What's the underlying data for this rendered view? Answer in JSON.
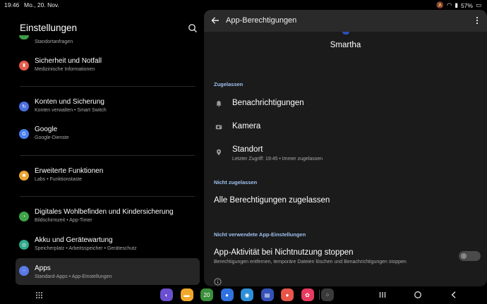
{
  "statusbar": {
    "time": "19:46",
    "date": "Mo., 20. Nov.",
    "battery": "57%"
  },
  "left": {
    "title": "Einstellungen",
    "partial_item_sub": "Standortanfragen",
    "items": [
      {
        "title": "Sicherheit und Notfall",
        "sub": "Medizinische Informationen",
        "color": "#e55a4a",
        "glyph": "♜"
      },
      {
        "title": "Konten und Sicherung",
        "sub": "Konten verwalten  •  Smart Switch",
        "color": "#4a6fe0",
        "glyph": "↻"
      },
      {
        "title": "Google",
        "sub": "Google-Dienste",
        "color": "#4a7ff0",
        "glyph": "G"
      },
      {
        "title": "Erweiterte Funktionen",
        "sub": "Labs  •  Funktionstaste",
        "color": "#e8a531",
        "glyph": "✱"
      },
      {
        "title": "Digitales Wohlbefinden und Kindersicherung",
        "sub": "Bildschirmzeit  •  App-Timer",
        "color": "#3fa44a",
        "glyph": "◔"
      },
      {
        "title": "Akku und Gerätewartung",
        "sub": "Speicherplatz  •  Arbeitsspeicher  •  Geräteschutz",
        "color": "#2fa98a",
        "glyph": "◎"
      },
      {
        "title": "Apps",
        "sub": "Standard-Apps  •  App-Einstellungen",
        "color": "#5a7ae8",
        "glyph": "⁘"
      }
    ]
  },
  "right": {
    "header_title": "App-Berechtigungen",
    "app_name": "Smartha",
    "section_allowed": "Zugelassen",
    "perm_notifications": "Benachrichtigungen",
    "perm_camera": "Kamera",
    "perm_location": "Standort",
    "perm_location_sub": "Letzter Zugriff: 19:45 • Immer zugelassen",
    "section_denied": "Nicht zugelassen",
    "allow_all": "Alle Berechtigungen zugelassen",
    "section_unused": "Nicht verwendete App-Einstellungen",
    "pause_title": "App-Aktivität bei Nichtnutzung stoppen",
    "pause_sub": "Berechtigungen entfernen, temporäre Dateien löschen und Benachrichtigungen stoppen",
    "pause_toggle": false
  },
  "taskbar": {
    "apps": [
      {
        "name": "samsung-internet-app",
        "color": "#6b4fd0",
        "glyph": "◐"
      },
      {
        "name": "files-app",
        "color": "#f1a82a",
        "glyph": "▬"
      },
      {
        "name": "calendar-app",
        "color": "#3b8f3a",
        "glyph": "20"
      },
      {
        "name": "messages-app",
        "color": "#2f72e0",
        "glyph": "●"
      },
      {
        "name": "camera-app",
        "color": "#2f8fd8",
        "glyph": "◉"
      },
      {
        "name": "notes-app",
        "color": "#3552b8",
        "glyph": "▤"
      },
      {
        "name": "contacts-app",
        "color": "#e8554a",
        "glyph": "●"
      },
      {
        "name": "gallery-app",
        "color": "#e83a5f",
        "glyph": "✿"
      },
      {
        "name": "apps-folder",
        "color": "#3a3a3a",
        "glyph": "⁘"
      }
    ]
  }
}
